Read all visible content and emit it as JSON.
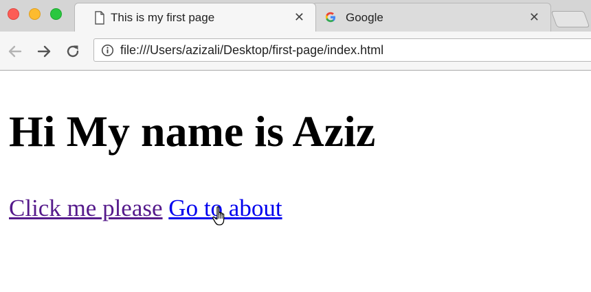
{
  "browser": {
    "tabs": [
      {
        "title": "This is my first page",
        "close": "✕",
        "active": true
      },
      {
        "title": "Google",
        "close": "✕",
        "active": false
      }
    ],
    "address": {
      "url": "file:///Users/azizali/Desktop/first-page/index.html"
    }
  },
  "page": {
    "heading": "Hi My name is Aziz",
    "links": [
      {
        "text": "Click me please",
        "state": "visited"
      },
      {
        "text": "Go to about",
        "state": "unvisited"
      }
    ]
  },
  "colors": {
    "visited_link": "#551a8b",
    "link": "#0000ee",
    "google_blue": "#4285f4",
    "google_red": "#ea4335",
    "google_yellow": "#fbbc05",
    "google_green": "#34a853"
  },
  "icons": [
    "document-icon",
    "google-icon",
    "back-icon",
    "forward-icon",
    "reload-icon",
    "info-icon",
    "hand-cursor-icon"
  ]
}
